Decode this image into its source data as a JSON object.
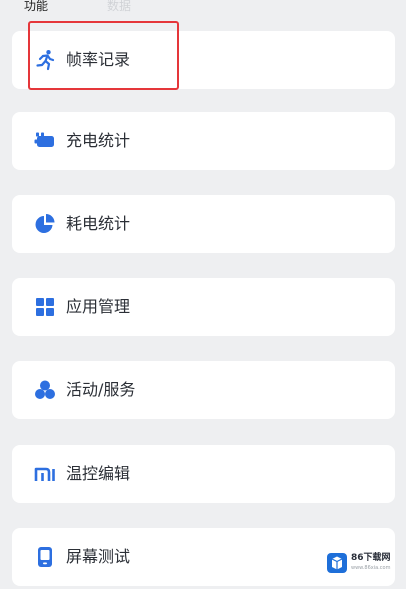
{
  "header": {
    "tab_active": "功能",
    "tab_inactive": "数据"
  },
  "menu": {
    "items": [
      {
        "label": "帧率记录",
        "icon": "running-person-icon"
      },
      {
        "label": "充电统计",
        "icon": "battery-charge-icon"
      },
      {
        "label": "耗电统计",
        "icon": "pie-chart-icon"
      },
      {
        "label": "应用管理",
        "icon": "grid-apps-icon"
      },
      {
        "label": "活动/服务",
        "icon": "three-circles-icon"
      },
      {
        "label": "温控编辑",
        "icon": "mi-logo-icon"
      },
      {
        "label": "屏幕测试",
        "icon": "phone-screen-icon"
      }
    ],
    "selected_index": 0
  },
  "colors": {
    "accent": "#2d6fe0",
    "highlight": "#e5363a",
    "card": "#ffffff",
    "background": "#eeeff1"
  },
  "watermark": {
    "brand": "86下载网",
    "url": "www.86xia.com"
  }
}
